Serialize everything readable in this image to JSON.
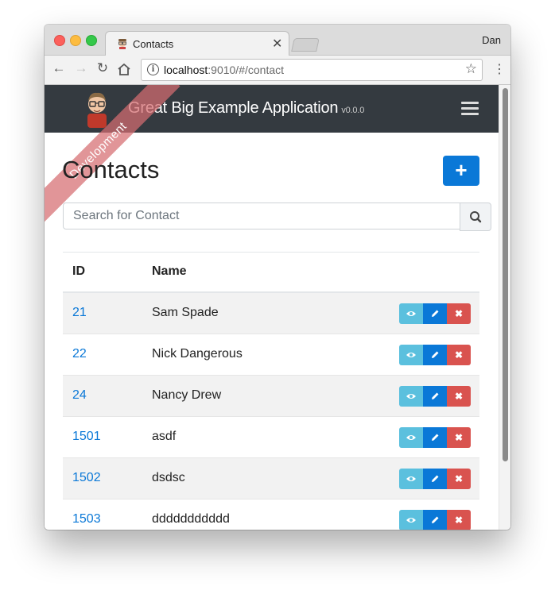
{
  "browser": {
    "tab_title": "Contacts",
    "profile_name": "Dan",
    "url_host": "localhost",
    "url_rest": ":9010/#/contact"
  },
  "app": {
    "brand_title": "Great Big Example Application",
    "brand_version": "v0.0.0",
    "environment_ribbon": "Development"
  },
  "page": {
    "title": "Contacts",
    "add_button_label": "+",
    "search_placeholder": "Search for Contact"
  },
  "table": {
    "headers": [
      "ID",
      "Name"
    ],
    "rows": [
      {
        "id": "21",
        "name": "Sam Spade"
      },
      {
        "id": "22",
        "name": "Nick Dangerous"
      },
      {
        "id": "24",
        "name": "Nancy Drew"
      },
      {
        "id": "1501",
        "name": "asdf"
      },
      {
        "id": "1502",
        "name": "dsdsc"
      },
      {
        "id": "1503",
        "name": "ddddddddddd"
      }
    ]
  },
  "colors": {
    "navbar": "#343a40",
    "primary": "#0a78d7",
    "info": "#5bc0de",
    "danger": "#d9534f",
    "ribbon": "#d56c70"
  },
  "icons": {
    "view": "eye-icon",
    "edit": "pencil-icon",
    "delete": "x-icon",
    "search": "search-icon",
    "menu": "hamburger-icon"
  }
}
